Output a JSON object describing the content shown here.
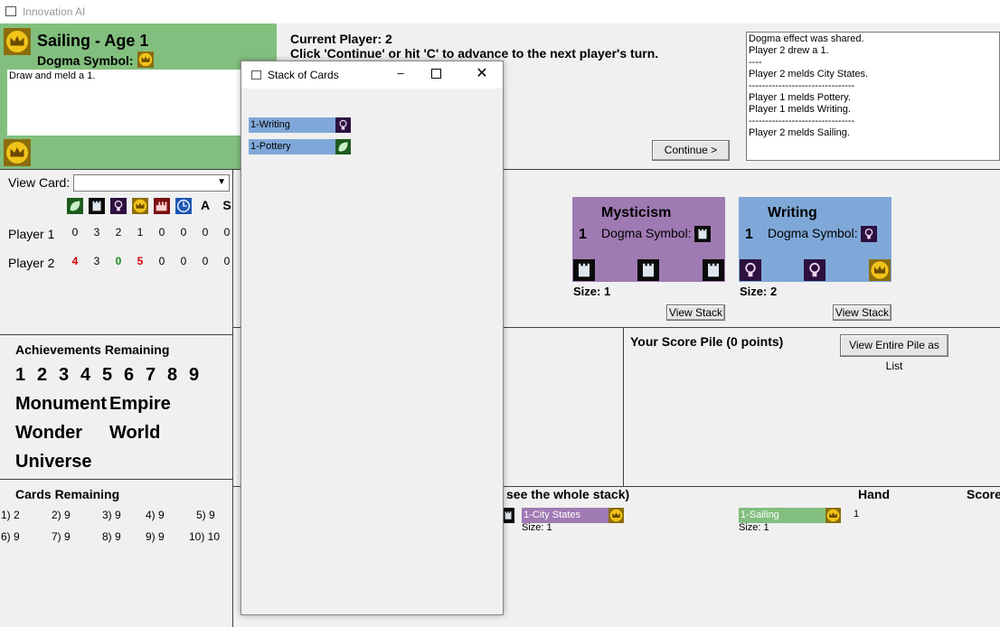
{
  "window": {
    "title": "Innovation AI"
  },
  "active_card": {
    "title": "Sailing - Age 1",
    "dogma_label": "Dogma Symbol:",
    "text": "Draw and meld a 1."
  },
  "status": {
    "current_player": "Current Player: 2",
    "instruction": "Click 'Continue' or hit 'C' to advance to the next player's turn."
  },
  "log": [
    "Dogma effect was shared.",
    "Player 2 drew a 1.",
    "----",
    "Player 2 melds City States.",
    "--------------------------------",
    "Player 1 melds Pottery.",
    "Player 1 melds Writing.",
    "--------------------------------",
    "Player 2 melds Sailing."
  ],
  "continue_button": "Continue >",
  "view_card": {
    "label": "View Card:",
    "value": ""
  },
  "symbols_table": {
    "headers": [
      "leaf-icon",
      "castle-icon",
      "lightbulb-icon",
      "crown-icon",
      "factory-icon",
      "clock-icon",
      "A",
      "S"
    ],
    "rows": [
      {
        "player": "Player 1",
        "values": [
          "0",
          "3",
          "2",
          "1",
          "0",
          "0",
          "0",
          "0"
        ]
      },
      {
        "player": "Player 2",
        "values": [
          "4",
          "3",
          "0",
          "5",
          "0",
          "0",
          "0",
          "0"
        ]
      }
    ]
  },
  "achievements": {
    "title": "Achievements Remaining",
    "numbers": [
      "1",
      "2",
      "3",
      "4",
      "5",
      "6",
      "7",
      "8",
      "9"
    ],
    "special": [
      "Monument",
      "Empire",
      "Wonder",
      "World",
      "Universe"
    ]
  },
  "cards_remaining": {
    "title": "Cards Remaining",
    "row1": [
      "1) 2",
      "2) 9",
      "3) 9",
      "4) 9",
      "5) 9"
    ],
    "row2": [
      "6) 9",
      "7) 9",
      "8) 9",
      "9) 9",
      "10) 10"
    ]
  },
  "board": {
    "purple": {
      "name": "Mysticism",
      "age": "1",
      "dogma_label": "Dogma Symbol:",
      "size": "Size: 1",
      "view_stack": "View Stack"
    },
    "blue": {
      "name": "Writing",
      "age": "1",
      "dogma_label": "Dogma Symbol:",
      "size": "Size: 2",
      "view_stack": "View Stack"
    }
  },
  "score_pile": {
    "title": "Your Score Pile (0 points)",
    "view_list": "View Entire Pile as List"
  },
  "opponent": {
    "header_partial": "see the whole stack)",
    "hand_label": "Hand",
    "score_label": "Score",
    "hand_count": "1",
    "purple_card": {
      "name": "1-City States",
      "size": "Size: 1"
    },
    "green_card": {
      "name": "1-Sailing",
      "size": "Size: 1"
    }
  },
  "popup": {
    "title": "Stack of Cards",
    "cards": [
      {
        "name": "1-Writing",
        "icon": "lightbulb-icon"
      },
      {
        "name": "1-Pottery",
        "icon": "leaf-icon"
      }
    ]
  },
  "colors": {
    "green": "#82bf7e",
    "purple": "#a07ab3",
    "blue": "#7fa8d8"
  }
}
